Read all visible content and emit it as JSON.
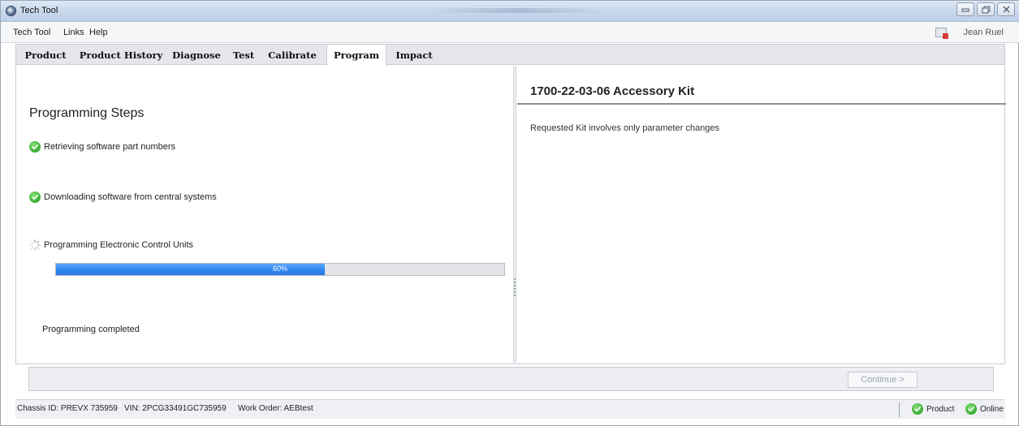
{
  "window": {
    "title": "Tech Tool"
  },
  "menu": {
    "items": [
      "Tech Tool",
      "Links",
      "Help"
    ],
    "user_name": "Jean Ruel"
  },
  "tabs": [
    {
      "label": "Product",
      "active": false
    },
    {
      "label": "Product History",
      "active": false
    },
    {
      "label": "Diagnose",
      "active": false
    },
    {
      "label": "Test",
      "active": false
    },
    {
      "label": "Calibrate",
      "active": false
    },
    {
      "label": "Program",
      "active": true
    },
    {
      "label": "Impact",
      "active": false
    }
  ],
  "left_pane": {
    "title": "Programming Steps",
    "steps": [
      {
        "label": "Retrieving software part numbers",
        "status": "done"
      },
      {
        "label": "Downloading software from central systems",
        "status": "done"
      },
      {
        "label": "Programming Electronic Control Units",
        "status": "in-progress"
      }
    ],
    "progress": {
      "label": "60%",
      "percent": 60
    },
    "completed_label": "Programming completed"
  },
  "right_pane": {
    "kit_title": "1700-22-03-06 Accessory Kit",
    "description": "Requested Kit involves only parameter changes"
  },
  "actions": {
    "continue_label": "Continue >"
  },
  "status": {
    "chassis": "Chassis ID: PREVX 735959",
    "vin": "VIN: 2PCG33491GC735959",
    "work_order": "Work Order: AEBtest",
    "product": "Product",
    "online": "Online"
  },
  "colors": {
    "progress_fill": "#2f86f0",
    "check_green": "#3fb33a",
    "accent_text": "#222222"
  }
}
